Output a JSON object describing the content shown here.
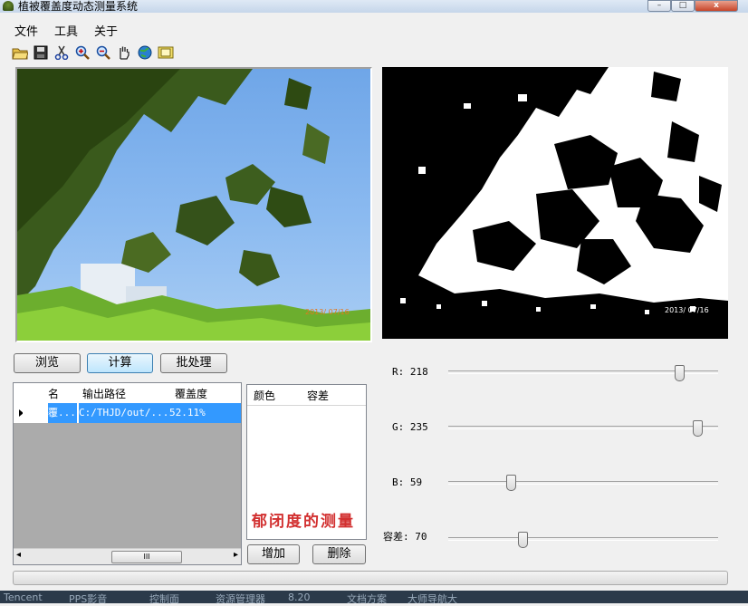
{
  "window": {
    "title": "植被覆盖度动态测量系统",
    "min_label": "–",
    "max_label": "□",
    "close_label": "x"
  },
  "menu": {
    "items": [
      "文件",
      "工具",
      "关于"
    ]
  },
  "toolbar": {
    "icons": [
      "open-folder-icon",
      "save-icon",
      "cut-icon",
      "zoom-in-icon",
      "zoom-out-icon",
      "pan-hand-icon",
      "globe-icon",
      "film-icon"
    ]
  },
  "images": {
    "left_timestamp": "2013/ 07/16",
    "right_timestamp": "2013/ 07/16"
  },
  "buttons": {
    "browse": "浏览",
    "compute": "计算",
    "batch": "批处理",
    "add": "增加",
    "delete": "删除"
  },
  "results_table": {
    "columns": [
      "名",
      "输出路径",
      "覆盖度"
    ],
    "rows": [
      {
        "name": "覆...",
        "path": "C:/THJD/out/...",
        "coverage": "52.11%"
      }
    ],
    "scroll_grip": "III"
  },
  "color_table": {
    "columns": [
      "颜色",
      "容差"
    ]
  },
  "watermark": "郁闭度的测量",
  "sliders": {
    "r": {
      "label": "R:",
      "value": "218",
      "level": 218,
      "max": 255
    },
    "g": {
      "label": "G:",
      "value": "235",
      "level": 235,
      "max": 255
    },
    "b": {
      "label": "B:",
      "value": "59",
      "level": 59,
      "max": 255
    },
    "tol": {
      "label": "容差:",
      "value": "70",
      "level": 70,
      "max": 255
    }
  },
  "taskbar": {
    "items": [
      "Tencent",
      "PPS影音",
      "控制面",
      "资源管理器",
      "8.20",
      "文档方案",
      "大师导航大"
    ]
  },
  "colors": {
    "selection": "#3399ff",
    "accent": "#3c7fb1",
    "watermark": "#d23030"
  }
}
